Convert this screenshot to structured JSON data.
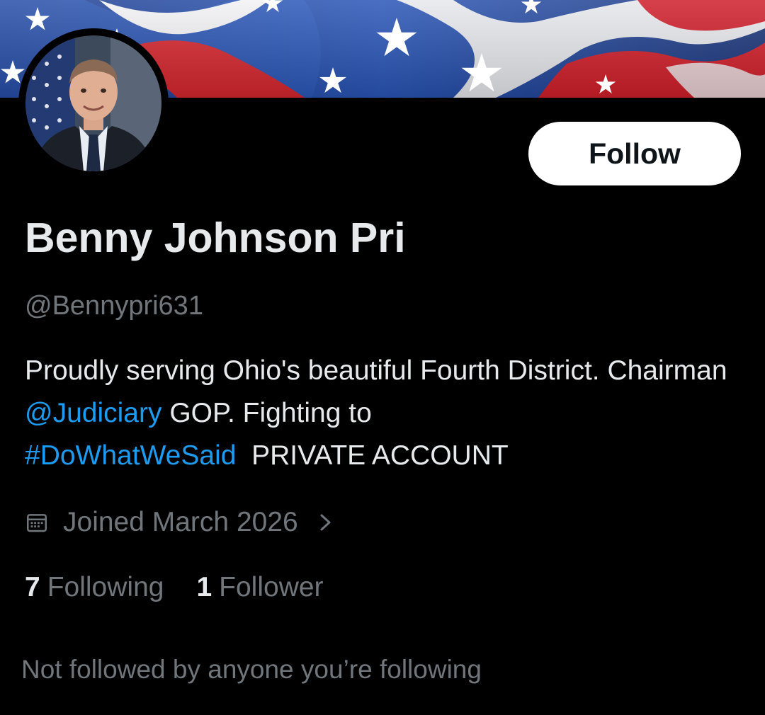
{
  "profile": {
    "display_name": "Benny Johnson Pri",
    "handle": "@Bennypri631",
    "follow_label": "Follow",
    "bio": {
      "part1": "Proudly serving Ohio's beautiful Fourth District. Chairman ",
      "mention": "@Judiciary",
      "part2": " GOP. Fighting to ",
      "hashtag": "#DoWhatWeSaid",
      "part3": "  PRIVATE ACCOUNT"
    },
    "joined": "Joined March 2026",
    "following_count": "7",
    "following_label": "Following",
    "followers_count": "1",
    "followers_label": "Follower",
    "not_followed_text": "Not followed by anyone you’re following"
  },
  "icons": {
    "calendar": "calendar-icon",
    "chevron": "chevron-right-icon"
  },
  "colors": {
    "background": "#000000",
    "primary_text": "#e7e9ea",
    "secondary_text": "#71767b",
    "link": "#1d9bf0",
    "follow_button_bg": "#ffffff"
  }
}
